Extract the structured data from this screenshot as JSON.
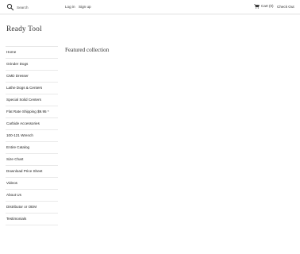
{
  "header": {
    "search_placeholder": "Search",
    "login": "Log in",
    "signup": "Sign up",
    "cart": "Cart (0)",
    "checkout": "Check Out"
  },
  "brand": {
    "logo_text": "Ready Tool"
  },
  "sidebar": {
    "items": [
      {
        "label": "Home"
      },
      {
        "label": "Grinder Dogs"
      },
      {
        "label": "CMD Dresser"
      },
      {
        "label": "Lathe Dogs & Centers"
      },
      {
        "label": "Special Solid Centers"
      },
      {
        "label": "Flat Rate Shipping $9.95 *"
      },
      {
        "label": "Carbide Accessories"
      },
      {
        "label": "100-121 Wrench"
      },
      {
        "label": "Entire Catalog"
      },
      {
        "label": "Size Chart"
      },
      {
        "label": "Download Price Sheet"
      },
      {
        "label": "Videos"
      },
      {
        "label": "About Us"
      },
      {
        "label": "Distributor or OEM"
      },
      {
        "label": "Testimonials"
      }
    ]
  },
  "main": {
    "title": "Featured collection"
  },
  "icons": {
    "search": "search-icon",
    "cart": "cart-icon"
  }
}
